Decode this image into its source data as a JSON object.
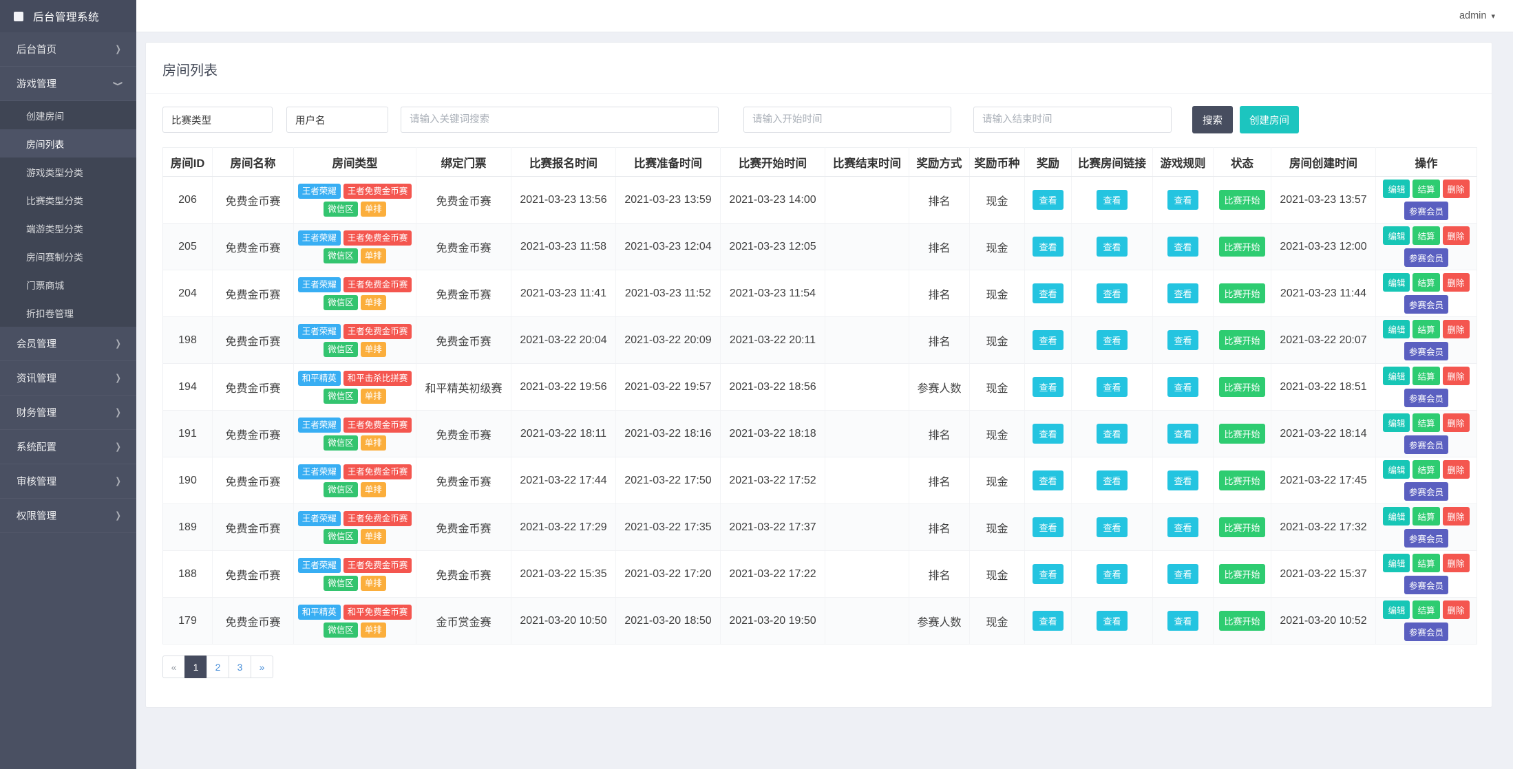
{
  "app": {
    "title": "后台管理系统"
  },
  "topbar": {
    "user": "admin"
  },
  "sidebar": {
    "items": [
      {
        "label": "后台首页",
        "expanded": false,
        "children": []
      },
      {
        "label": "游戏管理",
        "expanded": true,
        "children": [
          "创建房间",
          "房间列表",
          "游戏类型分类",
          "比赛类型分类",
          "端游类型分类",
          "房间赛制分类",
          "门票商城",
          "折扣卷管理"
        ],
        "active_child": "房间列表"
      },
      {
        "label": "会员管理",
        "expanded": false,
        "children": []
      },
      {
        "label": "资讯管理",
        "expanded": false,
        "children": []
      },
      {
        "label": "财务管理",
        "expanded": false,
        "children": []
      },
      {
        "label": "系统配置",
        "expanded": false,
        "children": []
      },
      {
        "label": "审核管理",
        "expanded": false,
        "children": []
      },
      {
        "label": "权限管理",
        "expanded": false,
        "children": []
      }
    ]
  },
  "page": {
    "title": "房间列表"
  },
  "filters": {
    "type_value": "比赛类型",
    "username_value": "用户名",
    "keyword_placeholder": "请输入关键词搜索",
    "start_placeholder": "请输入开始时间",
    "end_placeholder": "请输入结束时间",
    "search_label": "搜索",
    "create_label": "创建房间"
  },
  "table": {
    "columns": [
      "房间ID",
      "房间名称",
      "房间类型",
      "绑定门票",
      "比赛报名时间",
      "比赛准备时间",
      "比赛开始时间",
      "比赛结束时间",
      "奖励方式",
      "奖励币种",
      "奖励",
      "比赛房间链接",
      "游戏规则",
      "状态",
      "房间创建时间",
      "操作"
    ],
    "view_label": "查看",
    "status_label": "比赛开始",
    "action_labels": {
      "edit": "编辑",
      "settle": "结算",
      "delete": "删除",
      "members": "参赛会员"
    },
    "rows": [
      {
        "id": "206",
        "name": "免费金币赛",
        "badges": [
          [
            "王者荣耀",
            "blue"
          ],
          [
            "王者免费金币赛",
            "red"
          ],
          [
            "微信区",
            "green"
          ],
          [
            "单排",
            "orange"
          ]
        ],
        "ticket": "免费金币赛",
        "signup": "2021-03-23 13:56",
        "ready": "2021-03-23 13:59",
        "start": "2021-03-23 14:00",
        "end": "",
        "reward_mode": "排名",
        "currency": "现金",
        "created": "2021-03-23 13:57"
      },
      {
        "id": "205",
        "name": "免费金币赛",
        "badges": [
          [
            "王者荣耀",
            "blue"
          ],
          [
            "王者免费金币赛",
            "red"
          ],
          [
            "微信区",
            "green"
          ],
          [
            "单排",
            "orange"
          ]
        ],
        "ticket": "免费金币赛",
        "signup": "2021-03-23 11:58",
        "ready": "2021-03-23 12:04",
        "start": "2021-03-23 12:05",
        "end": "",
        "reward_mode": "排名",
        "currency": "现金",
        "created": "2021-03-23 12:00"
      },
      {
        "id": "204",
        "name": "免费金币赛",
        "badges": [
          [
            "王者荣耀",
            "blue"
          ],
          [
            "王者免费金币赛",
            "red"
          ],
          [
            "微信区",
            "green"
          ],
          [
            "单排",
            "orange"
          ]
        ],
        "ticket": "免费金币赛",
        "signup": "2021-03-23 11:41",
        "ready": "2021-03-23 11:52",
        "start": "2021-03-23 11:54",
        "end": "",
        "reward_mode": "排名",
        "currency": "现金",
        "created": "2021-03-23 11:44"
      },
      {
        "id": "198",
        "name": "免费金币赛",
        "badges": [
          [
            "王者荣耀",
            "blue"
          ],
          [
            "王者免费金币赛",
            "red"
          ],
          [
            "微信区",
            "green"
          ],
          [
            "单排",
            "orange"
          ]
        ],
        "ticket": "免费金币赛",
        "signup": "2021-03-22 20:04",
        "ready": "2021-03-22 20:09",
        "start": "2021-03-22 20:11",
        "end": "",
        "reward_mode": "排名",
        "currency": "现金",
        "created": "2021-03-22 20:07"
      },
      {
        "id": "194",
        "name": "免费金币赛",
        "badges": [
          [
            "和平精英",
            "blue"
          ],
          [
            "和平击杀比拼赛",
            "red"
          ],
          [
            "微信区",
            "green"
          ],
          [
            "单排",
            "orange"
          ]
        ],
        "ticket": "和平精英初级赛",
        "signup": "2021-03-22 19:56",
        "ready": "2021-03-22 19:57",
        "start": "2021-03-22 18:56",
        "end": "",
        "reward_mode": "参赛人数",
        "currency": "现金",
        "created": "2021-03-22 18:51"
      },
      {
        "id": "191",
        "name": "免费金币赛",
        "badges": [
          [
            "王者荣耀",
            "blue"
          ],
          [
            "王者免费金币赛",
            "red"
          ],
          [
            "微信区",
            "green"
          ],
          [
            "单排",
            "orange"
          ]
        ],
        "ticket": "免费金币赛",
        "signup": "2021-03-22 18:11",
        "ready": "2021-03-22 18:16",
        "start": "2021-03-22 18:18",
        "end": "",
        "reward_mode": "排名",
        "currency": "现金",
        "created": "2021-03-22 18:14"
      },
      {
        "id": "190",
        "name": "免费金币赛",
        "badges": [
          [
            "王者荣耀",
            "blue"
          ],
          [
            "王者免费金币赛",
            "red"
          ],
          [
            "微信区",
            "green"
          ],
          [
            "单排",
            "orange"
          ]
        ],
        "ticket": "免费金币赛",
        "signup": "2021-03-22 17:44",
        "ready": "2021-03-22 17:50",
        "start": "2021-03-22 17:52",
        "end": "",
        "reward_mode": "排名",
        "currency": "现金",
        "created": "2021-03-22 17:45"
      },
      {
        "id": "189",
        "name": "免费金币赛",
        "badges": [
          [
            "王者荣耀",
            "blue"
          ],
          [
            "王者免费金币赛",
            "red"
          ],
          [
            "微信区",
            "green"
          ],
          [
            "单排",
            "orange"
          ]
        ],
        "ticket": "免费金币赛",
        "signup": "2021-03-22 17:29",
        "ready": "2021-03-22 17:35",
        "start": "2021-03-22 17:37",
        "end": "",
        "reward_mode": "排名",
        "currency": "现金",
        "created": "2021-03-22 17:32"
      },
      {
        "id": "188",
        "name": "免费金币赛",
        "badges": [
          [
            "王者荣耀",
            "blue"
          ],
          [
            "王者免费金币赛",
            "red"
          ],
          [
            "微信区",
            "green"
          ],
          [
            "单排",
            "orange"
          ]
        ],
        "ticket": "免费金币赛",
        "signup": "2021-03-22 15:35",
        "ready": "2021-03-22 17:20",
        "start": "2021-03-22 17:22",
        "end": "",
        "reward_mode": "排名",
        "currency": "现金",
        "created": "2021-03-22 15:37"
      },
      {
        "id": "179",
        "name": "免费金币赛",
        "badges": [
          [
            "和平精英",
            "blue"
          ],
          [
            "和平免费金币赛",
            "red"
          ],
          [
            "微信区",
            "green"
          ],
          [
            "单排",
            "orange"
          ]
        ],
        "ticket": "金币赏金赛",
        "signup": "2021-03-20 10:50",
        "ready": "2021-03-20 18:50",
        "start": "2021-03-20 19:50",
        "end": "",
        "reward_mode": "参赛人数",
        "currency": "现金",
        "created": "2021-03-20 10:52"
      }
    ]
  },
  "pagination": {
    "prev": "«",
    "pages": [
      "1",
      "2",
      "3"
    ],
    "next": "»",
    "active": "1"
  },
  "colors": {
    "sidebar": "#4a5062",
    "sidebar_submenu": "#3f4554",
    "accent_teal": "#1cc5bf",
    "dark_slate": "#474d5f",
    "view_cyan": "#24c4e0",
    "status_green": "#2ecc71",
    "edit_teal": "#17c6b6",
    "delete_red": "#f4564f",
    "members_indigo": "#5a5fc0",
    "badge_blue": "#38aef3",
    "badge_red": "#f4564f",
    "badge_green": "#33c46f",
    "badge_orange": "#fbae3c",
    "page_bg": "#eef0f5"
  }
}
